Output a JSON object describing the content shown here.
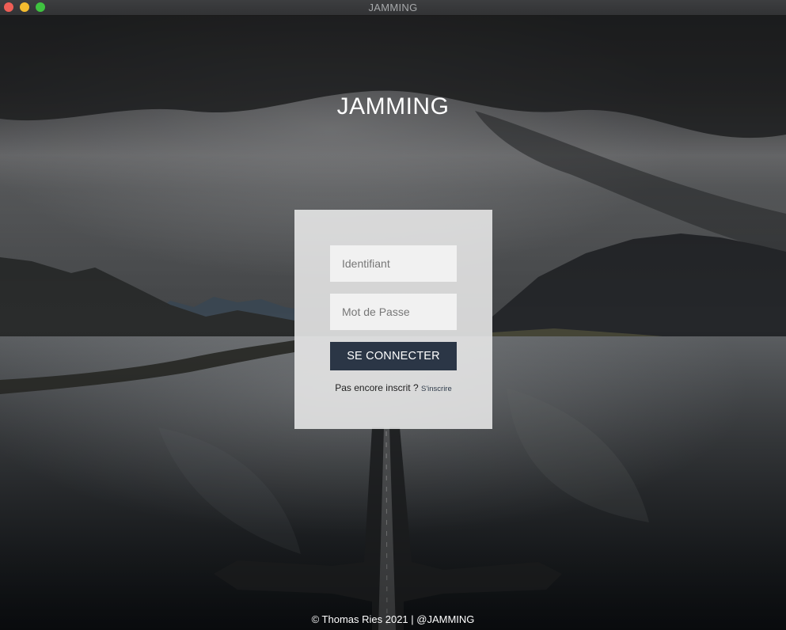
{
  "window": {
    "title": "JAMMING"
  },
  "header": {
    "title": "JAMMING"
  },
  "login": {
    "username_placeholder": "Identifiant",
    "username_value": "",
    "password_placeholder": "Mot de Passe",
    "password_value": "",
    "submit_label": "SE CONNECTER",
    "signup_prompt": "Pas encore inscrit ?",
    "signup_link": "S'inscrire"
  },
  "footer": {
    "text": "© Thomas Ries 2021 | @JAMMING"
  },
  "colors": {
    "button_bg": "#2b3646",
    "panel_bg": "#ececec",
    "titlebar": "#38393b"
  }
}
